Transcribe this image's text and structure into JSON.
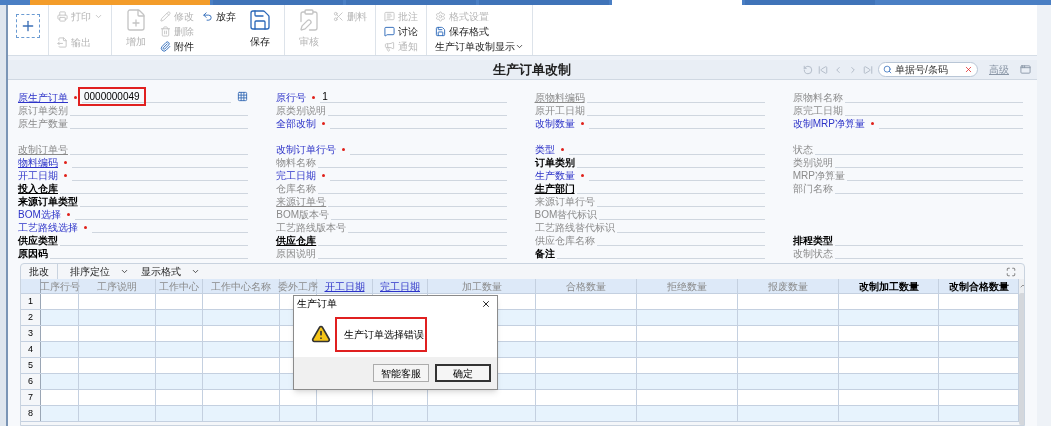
{
  "tab_strip": [
    {
      "selected": false
    },
    {
      "selected": false
    },
    {
      "selected": false
    },
    {
      "selected": false
    },
    {
      "selected": true
    },
    {
      "selected": false
    }
  ],
  "toolbar": {
    "groups": [
      {
        "items": [
          {
            "kind": "new",
            "disabled": false
          }
        ]
      },
      {
        "items": [
          {
            "kind": "small",
            "label": "打印",
            "disabled": true,
            "dropdown": true
          },
          {
            "kind": "small",
            "label": "输出",
            "disabled": true,
            "dropdown": false
          }
        ]
      },
      {
        "items": [
          {
            "kind": "large",
            "label": "增加",
            "disabled": true
          },
          {
            "kind": "small",
            "label": "修改",
            "disabled": true,
            "dropdown": false
          },
          {
            "kind": "small",
            "label": "删除",
            "disabled": true,
            "dropdown": false
          },
          {
            "kind": "small",
            "label": "附件",
            "disabled": false,
            "dropdown": false
          },
          {
            "kind": "small",
            "label": "放弃",
            "disabled": false,
            "dropdown": false
          },
          {
            "kind": "large",
            "label": "保存",
            "disabled": false
          }
        ]
      },
      {
        "items": [
          {
            "kind": "large",
            "label": "审核",
            "disabled": true
          },
          {
            "kind": "small",
            "label": "删料",
            "disabled": true,
            "dropdown": false
          }
        ]
      },
      {
        "items": [
          {
            "kind": "small",
            "label": "批注",
            "disabled": true,
            "dropdown": false
          },
          {
            "kind": "small",
            "label": "讨论",
            "disabled": false,
            "dropdown": false
          },
          {
            "kind": "small",
            "label": "通知",
            "disabled": true,
            "dropdown": false
          }
        ]
      },
      {
        "items": [
          {
            "kind": "small",
            "label": "格式设置",
            "disabled": true,
            "dropdown": false
          },
          {
            "kind": "small",
            "label": "保存格式",
            "disabled": false,
            "dropdown": false
          },
          {
            "kind": "text",
            "label": "生产订单改制显示",
            "disabled": false,
            "dropdown": true
          }
        ]
      }
    ]
  },
  "form_title": "生产订单改制",
  "search": {
    "placeholder": "单据号/条码"
  },
  "advanced_link": "高级",
  "sections": [
    {
      "rows": [
        [
          {
            "label": "原生产订单",
            "kind": "link",
            "underlined": true,
            "required": true,
            "value": "0000000049",
            "highlighted": true,
            "lookup": true
          },
          {
            "label": "原行号",
            "kind": "link",
            "underlined": false,
            "required": true,
            "value": "1"
          },
          {
            "label": "原物料编码",
            "kind": "muted",
            "underlined": true,
            "required": false
          },
          {
            "label": "原物料名称",
            "kind": "muted",
            "underlined": false,
            "required": false
          }
        ],
        [
          {
            "label": "原订单类别",
            "kind": "muted",
            "underlined": false,
            "required": false
          },
          {
            "label": "原类别说明",
            "kind": "muted",
            "underlined": false,
            "required": false
          },
          {
            "label": "原开工日期",
            "kind": "muted",
            "underlined": false,
            "required": false
          },
          {
            "label": "原完工日期",
            "kind": "muted",
            "underlined": false,
            "required": false
          }
        ],
        [
          {
            "label": "原生产数量",
            "kind": "muted",
            "underlined": false,
            "required": false
          },
          {
            "label": "全部改制",
            "kind": "link",
            "underlined": false,
            "required": true
          },
          {
            "label": "改制数量",
            "kind": "link",
            "underlined": false,
            "required": true
          },
          {
            "label": "改制MRP净算量",
            "kind": "link",
            "underlined": false,
            "required": true
          }
        ]
      ]
    },
    {
      "rows": [
        [
          {
            "label": "改制订单号",
            "kind": "muted",
            "underlined": true,
            "required": false
          },
          {
            "label": "改制订单行号",
            "kind": "link",
            "underlined": false,
            "required": true
          },
          {
            "label": "类型",
            "kind": "link",
            "underlined": false,
            "required": true
          },
          {
            "label": "状态",
            "kind": "muted",
            "underlined": false,
            "required": false
          }
        ],
        [
          {
            "label": "物料编码",
            "kind": "link",
            "underlined": true,
            "required": true
          },
          {
            "label": "物料名称",
            "kind": "muted",
            "underlined": false,
            "required": false
          },
          {
            "label": "订单类别",
            "kind": "plain",
            "underlined": false,
            "required": false
          },
          {
            "label": "类别说明",
            "kind": "muted",
            "underlined": false,
            "required": false
          }
        ],
        [
          {
            "label": "开工日期",
            "kind": "link",
            "underlined": false,
            "required": true
          },
          {
            "label": "完工日期",
            "kind": "link",
            "underlined": false,
            "required": true
          },
          {
            "label": "生产数量",
            "kind": "link",
            "underlined": false,
            "required": true
          },
          {
            "label": "MRP净算量",
            "kind": "muted",
            "underlined": false,
            "required": false
          }
        ],
        [
          {
            "label": "投入仓库",
            "kind": "plain",
            "underlined": true,
            "required": false
          },
          {
            "label": "仓库名称",
            "kind": "muted",
            "underlined": false,
            "required": false
          },
          {
            "label": "生产部门",
            "kind": "plain",
            "underlined": true,
            "required": false
          },
          {
            "label": "部门名称",
            "kind": "muted",
            "underlined": false,
            "required": false
          }
        ],
        [
          {
            "label": "来源订单类型",
            "kind": "plain",
            "underlined": false,
            "required": false
          },
          {
            "label": "来源订单号",
            "kind": "muted",
            "underlined": true,
            "required": false
          },
          {
            "label": "来源订单行号",
            "kind": "muted",
            "underlined": false,
            "required": false
          }
        ],
        [
          {
            "label": "BOM选择",
            "kind": "link",
            "underlined": false,
            "required": true
          },
          {
            "label": "BOM版本号",
            "kind": "muted",
            "underlined": false,
            "required": false
          },
          {
            "label": "BOM替代标识",
            "kind": "muted",
            "underlined": false,
            "required": false
          }
        ],
        [
          {
            "label": "工艺路线选择",
            "kind": "link",
            "underlined": false,
            "required": true
          },
          {
            "label": "工艺路线版本号",
            "kind": "muted",
            "underlined": false,
            "required": false
          },
          {
            "label": "工艺路线替代标识",
            "kind": "muted",
            "underlined": false,
            "required": false
          }
        ],
        [
          {
            "label": "供应类型",
            "kind": "plain",
            "underlined": false,
            "required": false
          },
          {
            "label": "供应仓库",
            "kind": "plain",
            "underlined": true,
            "required": false
          },
          {
            "label": "供应仓库名称",
            "kind": "muted",
            "underlined": false,
            "required": false
          },
          {
            "label": "排程类型",
            "kind": "plain",
            "underlined": false,
            "required": false
          }
        ],
        [
          {
            "label": "原因码",
            "kind": "plain",
            "underlined": false,
            "required": false
          },
          {
            "label": "原因说明",
            "kind": "muted",
            "underlined": false,
            "required": false
          },
          {
            "label": "备注",
            "kind": "plain",
            "underlined": false,
            "required": false
          },
          {
            "label": "改制状态",
            "kind": "muted",
            "underlined": false,
            "required": false
          }
        ]
      ]
    }
  ],
  "grid_toolbar": [
    {
      "label": "批改",
      "dropdown": false
    },
    {
      "label": "排序定位",
      "dropdown": true
    },
    {
      "label": "显示格式",
      "dropdown": true
    }
  ],
  "table": {
    "columns": [
      {
        "label": "工序行号",
        "kind": "muted"
      },
      {
        "label": "工序说明",
        "kind": "muted"
      },
      {
        "label": "工作中心",
        "kind": "muted"
      },
      {
        "label": "工作中心名称",
        "kind": "muted"
      },
      {
        "label": "委外工序",
        "kind": "muted"
      },
      {
        "label": "开工日期",
        "kind": "link"
      },
      {
        "label": "完工日期",
        "kind": "link"
      },
      {
        "label": "加工数量",
        "kind": "muted"
      },
      {
        "label": "合格数量",
        "kind": "muted"
      },
      {
        "label": "拒绝数量",
        "kind": "muted"
      },
      {
        "label": "报废数量",
        "kind": "muted"
      },
      {
        "label": "改制加工数量",
        "kind": "plain"
      },
      {
        "label": "改制合格数量",
        "kind": "plain"
      }
    ],
    "rows": [
      "1",
      "2",
      "3",
      "4",
      "5",
      "6",
      "7",
      "8"
    ]
  },
  "dialog": {
    "title": "生产订单",
    "message": "生产订单选择错误",
    "buttons": [
      {
        "label": "智能客服",
        "default": false
      },
      {
        "label": "确定",
        "default": true
      }
    ]
  }
}
